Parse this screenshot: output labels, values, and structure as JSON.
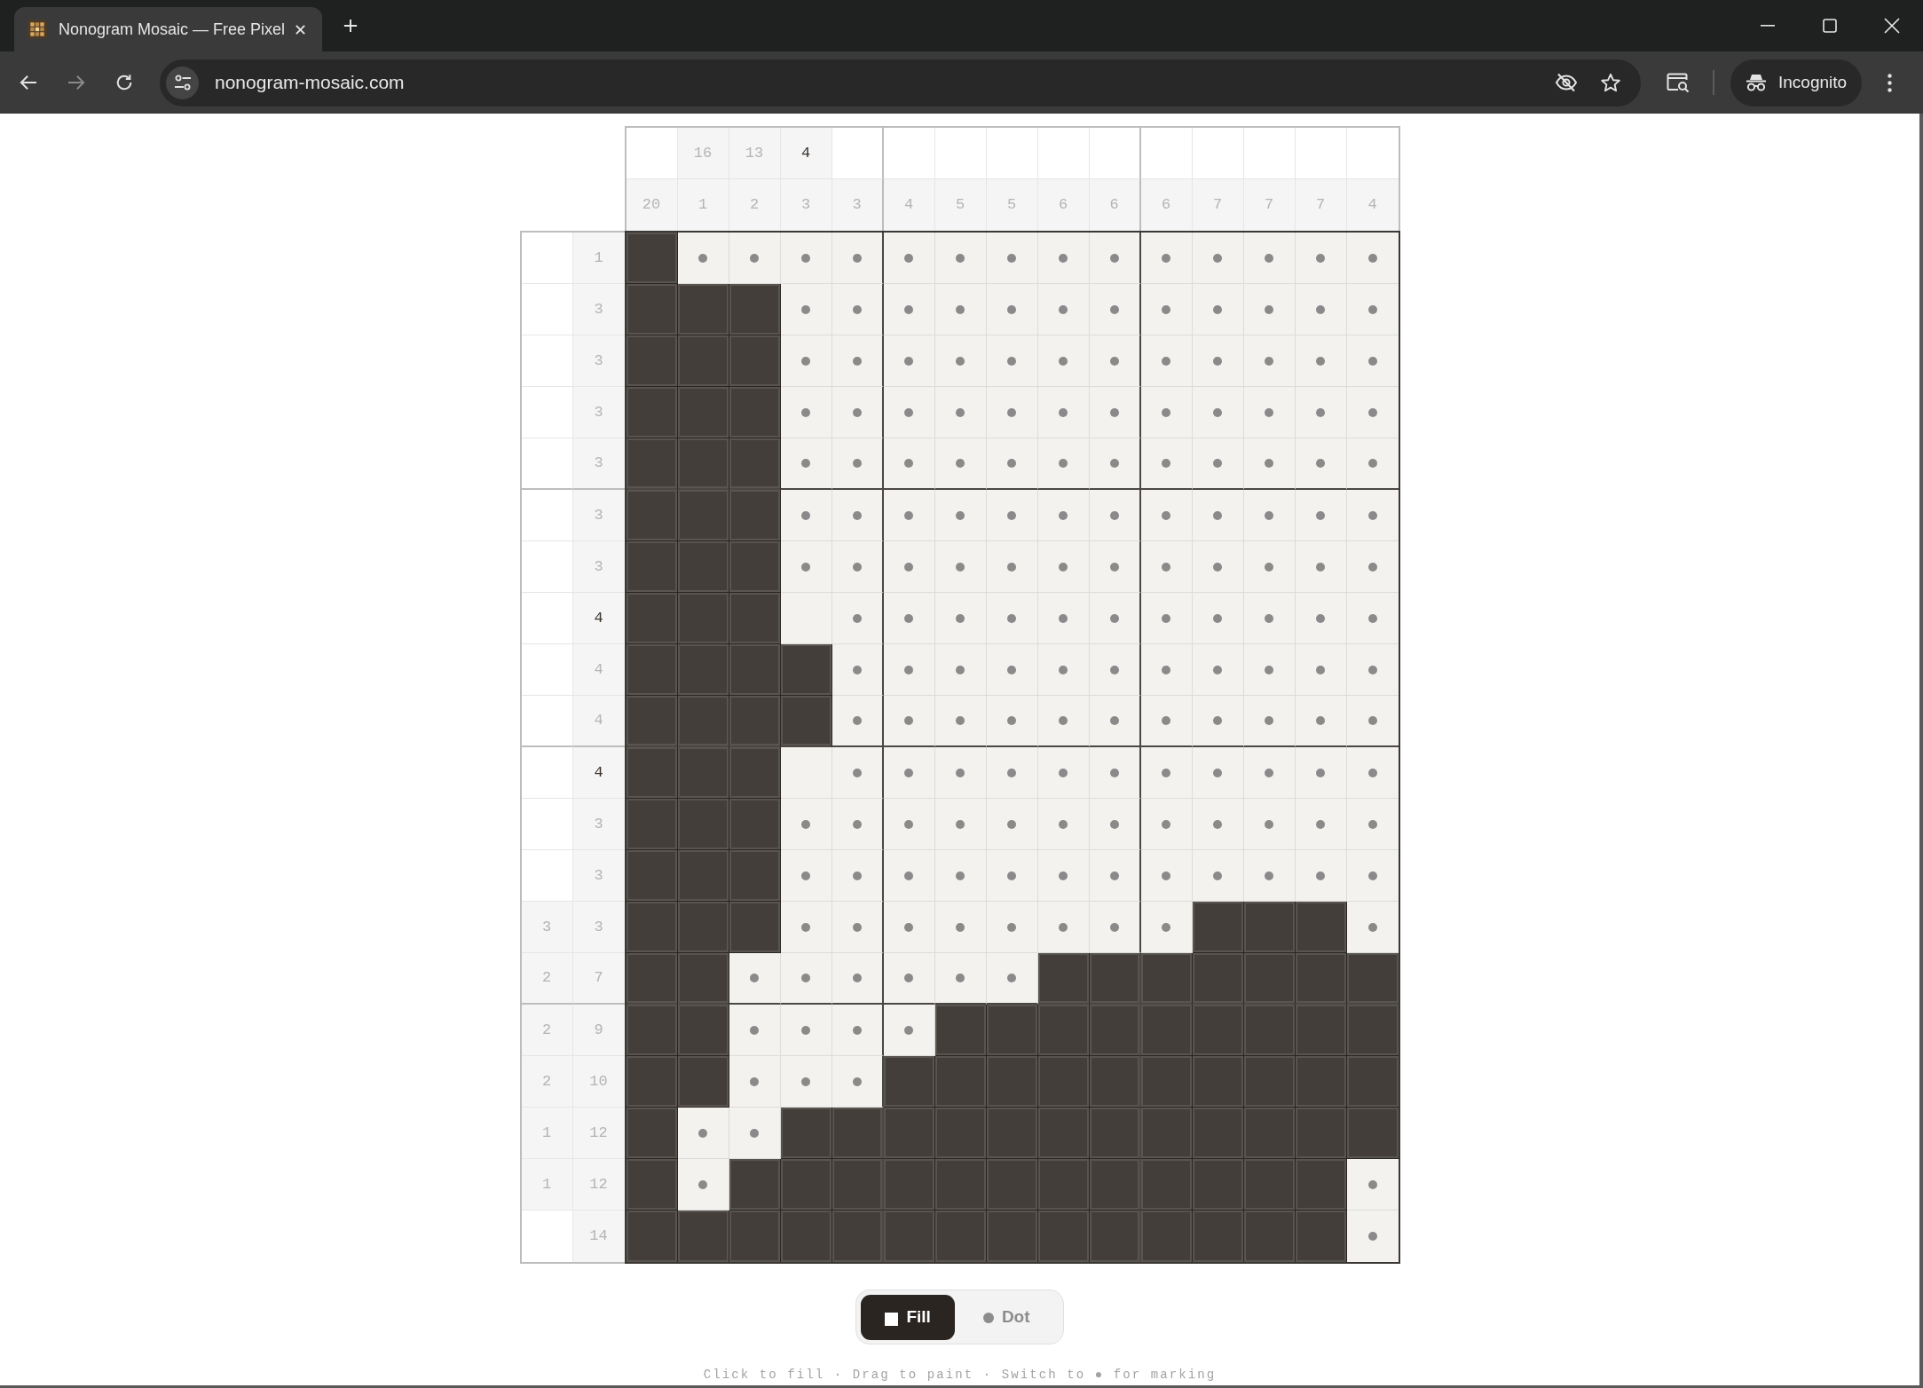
{
  "browser": {
    "tab_title": "Nonogram Mosaic — Free Pixel",
    "address": "nonogram-mosaic.com",
    "profile_label": "Incognito"
  },
  "column_clues": [
    [
      {
        "number": "20",
        "completed": true
      }
    ],
    [
      {
        "number": "16",
        "completed": true
      },
      {
        "number": "1",
        "completed": true
      }
    ],
    [
      {
        "number": "13",
        "completed": true
      },
      {
        "number": "2",
        "completed": true
      }
    ],
    [
      {
        "number": "4",
        "completed": false
      },
      {
        "number": "3",
        "completed": true
      }
    ],
    [
      {
        "number": "3",
        "completed": true
      }
    ],
    [
      {
        "number": "4",
        "completed": true
      }
    ],
    [
      {
        "number": "5",
        "completed": true
      }
    ],
    [
      {
        "number": "5",
        "completed": true
      }
    ],
    [
      {
        "number": "6",
        "completed": true
      }
    ],
    [
      {
        "number": "6",
        "completed": true
      }
    ],
    [
      {
        "number": "6",
        "completed": true
      }
    ],
    [
      {
        "number": "7",
        "completed": true
      }
    ],
    [
      {
        "number": "7",
        "completed": true
      }
    ],
    [
      {
        "number": "7",
        "completed": true
      }
    ],
    [
      {
        "number": "4",
        "completed": true
      }
    ]
  ],
  "row_clues": [
    [
      {
        "number": "1",
        "completed": true
      }
    ],
    [
      {
        "number": "3",
        "completed": true
      }
    ],
    [
      {
        "number": "3",
        "completed": true
      }
    ],
    [
      {
        "number": "3",
        "completed": true
      }
    ],
    [
      {
        "number": "3",
        "completed": true
      }
    ],
    [
      {
        "number": "3",
        "completed": true
      }
    ],
    [
      {
        "number": "3",
        "completed": true
      }
    ],
    [
      {
        "number": "4",
        "completed": false
      }
    ],
    [
      {
        "number": "4",
        "completed": true
      }
    ],
    [
      {
        "number": "4",
        "completed": true
      }
    ],
    [
      {
        "number": "4",
        "completed": false
      }
    ],
    [
      {
        "number": "3",
        "completed": true
      }
    ],
    [
      {
        "number": "3",
        "completed": true
      }
    ],
    [
      {
        "number": "3",
        "completed": true
      },
      {
        "number": "3",
        "completed": true
      }
    ],
    [
      {
        "number": "2",
        "completed": true
      },
      {
        "number": "7",
        "completed": true
      }
    ],
    [
      {
        "number": "2",
        "completed": true
      },
      {
        "number": "9",
        "completed": true
      }
    ],
    [
      {
        "number": "2",
        "completed": true
      },
      {
        "number": "10",
        "completed": true
      }
    ],
    [
      {
        "number": "1",
        "completed": true
      },
      {
        "number": "12",
        "completed": true
      }
    ],
    [
      {
        "number": "1",
        "completed": true
      },
      {
        "number": "12",
        "completed": true
      }
    ],
    [
      {
        "number": "14",
        "completed": true
      }
    ]
  ],
  "grid": [
    [
      {
        "kind": "filled"
      },
      {
        "kind": "dot"
      },
      {
        "kind": "dot"
      },
      {
        "kind": "dot"
      },
      {
        "kind": "dot"
      },
      {
        "kind": "dot"
      },
      {
        "kind": "dot"
      },
      {
        "kind": "dot"
      },
      {
        "kind": "dot"
      },
      {
        "kind": "dot"
      },
      {
        "kind": "dot"
      },
      {
        "kind": "dot"
      },
      {
        "kind": "dot"
      },
      {
        "kind": "dot"
      },
      {
        "kind": "dot"
      }
    ],
    [
      {
        "kind": "filled"
      },
      {
        "kind": "filled"
      },
      {
        "kind": "filled"
      },
      {
        "kind": "dot"
      },
      {
        "kind": "dot"
      },
      {
        "kind": "dot"
      },
      {
        "kind": "dot"
      },
      {
        "kind": "dot"
      },
      {
        "kind": "dot"
      },
      {
        "kind": "dot"
      },
      {
        "kind": "dot"
      },
      {
        "kind": "dot"
      },
      {
        "kind": "dot"
      },
      {
        "kind": "dot"
      },
      {
        "kind": "dot"
      }
    ],
    [
      {
        "kind": "filled"
      },
      {
        "kind": "filled"
      },
      {
        "kind": "filled"
      },
      {
        "kind": "dot"
      },
      {
        "kind": "dot"
      },
      {
        "kind": "dot"
      },
      {
        "kind": "dot"
      },
      {
        "kind": "dot"
      },
      {
        "kind": "dot"
      },
      {
        "kind": "dot"
      },
      {
        "kind": "dot"
      },
      {
        "kind": "dot"
      },
      {
        "kind": "dot"
      },
      {
        "kind": "dot"
      },
      {
        "kind": "dot"
      }
    ],
    [
      {
        "kind": "filled"
      },
      {
        "kind": "filled"
      },
      {
        "kind": "filled"
      },
      {
        "kind": "dot"
      },
      {
        "kind": "dot"
      },
      {
        "kind": "dot"
      },
      {
        "kind": "dot"
      },
      {
        "kind": "dot"
      },
      {
        "kind": "dot"
      },
      {
        "kind": "dot"
      },
      {
        "kind": "dot"
      },
      {
        "kind": "dot"
      },
      {
        "kind": "dot"
      },
      {
        "kind": "dot"
      },
      {
        "kind": "dot"
      }
    ],
    [
      {
        "kind": "filled"
      },
      {
        "kind": "filled"
      },
      {
        "kind": "filled"
      },
      {
        "kind": "dot"
      },
      {
        "kind": "dot"
      },
      {
        "kind": "dot"
      },
      {
        "kind": "dot"
      },
      {
        "kind": "dot"
      },
      {
        "kind": "dot"
      },
      {
        "kind": "dot"
      },
      {
        "kind": "dot"
      },
      {
        "kind": "dot"
      },
      {
        "kind": "dot"
      },
      {
        "kind": "dot"
      },
      {
        "kind": "dot"
      }
    ],
    [
      {
        "kind": "filled"
      },
      {
        "kind": "filled"
      },
      {
        "kind": "filled"
      },
      {
        "kind": "dot"
      },
      {
        "kind": "dot"
      },
      {
        "kind": "dot"
      },
      {
        "kind": "dot"
      },
      {
        "kind": "dot"
      },
      {
        "kind": "dot"
      },
      {
        "kind": "dot"
      },
      {
        "kind": "dot"
      },
      {
        "kind": "dot"
      },
      {
        "kind": "dot"
      },
      {
        "kind": "dot"
      },
      {
        "kind": "dot"
      }
    ],
    [
      {
        "kind": "filled"
      },
      {
        "kind": "filled"
      },
      {
        "kind": "filled"
      },
      {
        "kind": "dot"
      },
      {
        "kind": "dot"
      },
      {
        "kind": "dot"
      },
      {
        "kind": "dot"
      },
      {
        "kind": "dot"
      },
      {
        "kind": "dot"
      },
      {
        "kind": "dot"
      },
      {
        "kind": "dot"
      },
      {
        "kind": "dot"
      },
      {
        "kind": "dot"
      },
      {
        "kind": "dot"
      },
      {
        "kind": "dot"
      }
    ],
    [
      {
        "kind": "filled"
      },
      {
        "kind": "filled"
      },
      {
        "kind": "filled"
      },
      {
        "kind": "empty"
      },
      {
        "kind": "dot"
      },
      {
        "kind": "dot"
      },
      {
        "kind": "dot"
      },
      {
        "kind": "dot"
      },
      {
        "kind": "dot"
      },
      {
        "kind": "dot"
      },
      {
        "kind": "dot"
      },
      {
        "kind": "dot"
      },
      {
        "kind": "dot"
      },
      {
        "kind": "dot"
      },
      {
        "kind": "dot"
      }
    ],
    [
      {
        "kind": "filled"
      },
      {
        "kind": "filled"
      },
      {
        "kind": "filled"
      },
      {
        "kind": "filled"
      },
      {
        "kind": "dot"
      },
      {
        "kind": "dot"
      },
      {
        "kind": "dot"
      },
      {
        "kind": "dot"
      },
      {
        "kind": "dot"
      },
      {
        "kind": "dot"
      },
      {
        "kind": "dot"
      },
      {
        "kind": "dot"
      },
      {
        "kind": "dot"
      },
      {
        "kind": "dot"
      },
      {
        "kind": "dot"
      }
    ],
    [
      {
        "kind": "filled"
      },
      {
        "kind": "filled"
      },
      {
        "kind": "filled"
      },
      {
        "kind": "filled"
      },
      {
        "kind": "dot"
      },
      {
        "kind": "dot"
      },
      {
        "kind": "dot"
      },
      {
        "kind": "dot"
      },
      {
        "kind": "dot"
      },
      {
        "kind": "dot"
      },
      {
        "kind": "dot"
      },
      {
        "kind": "dot"
      },
      {
        "kind": "dot"
      },
      {
        "kind": "dot"
      },
      {
        "kind": "dot"
      }
    ],
    [
      {
        "kind": "filled"
      },
      {
        "kind": "filled"
      },
      {
        "kind": "filled"
      },
      {
        "kind": "empty"
      },
      {
        "kind": "dot"
      },
      {
        "kind": "dot"
      },
      {
        "kind": "dot"
      },
      {
        "kind": "dot"
      },
      {
        "kind": "dot"
      },
      {
        "kind": "dot"
      },
      {
        "kind": "dot"
      },
      {
        "kind": "dot"
      },
      {
        "kind": "dot"
      },
      {
        "kind": "dot"
      },
      {
        "kind": "dot"
      }
    ],
    [
      {
        "kind": "filled"
      },
      {
        "kind": "filled"
      },
      {
        "kind": "filled"
      },
      {
        "kind": "dot"
      },
      {
        "kind": "dot"
      },
      {
        "kind": "dot"
      },
      {
        "kind": "dot"
      },
      {
        "kind": "dot"
      },
      {
        "kind": "dot"
      },
      {
        "kind": "dot"
      },
      {
        "kind": "dot"
      },
      {
        "kind": "dot"
      },
      {
        "kind": "dot"
      },
      {
        "kind": "dot"
      },
      {
        "kind": "dot"
      }
    ],
    [
      {
        "kind": "filled"
      },
      {
        "kind": "filled"
      },
      {
        "kind": "filled"
      },
      {
        "kind": "dot"
      },
      {
        "kind": "dot"
      },
      {
        "kind": "dot"
      },
      {
        "kind": "dot"
      },
      {
        "kind": "dot"
      },
      {
        "kind": "dot"
      },
      {
        "kind": "dot"
      },
      {
        "kind": "dot"
      },
      {
        "kind": "dot"
      },
      {
        "kind": "dot"
      },
      {
        "kind": "dot"
      },
      {
        "kind": "dot"
      }
    ],
    [
      {
        "kind": "filled"
      },
      {
        "kind": "filled"
      },
      {
        "kind": "filled"
      },
      {
        "kind": "dot"
      },
      {
        "kind": "dot"
      },
      {
        "kind": "dot"
      },
      {
        "kind": "dot"
      },
      {
        "kind": "dot"
      },
      {
        "kind": "dot"
      },
      {
        "kind": "dot"
      },
      {
        "kind": "dot"
      },
      {
        "kind": "filled"
      },
      {
        "kind": "filled"
      },
      {
        "kind": "filled"
      },
      {
        "kind": "dot"
      }
    ],
    [
      {
        "kind": "filled"
      },
      {
        "kind": "filled"
      },
      {
        "kind": "dot"
      },
      {
        "kind": "dot"
      },
      {
        "kind": "dot"
      },
      {
        "kind": "dot"
      },
      {
        "kind": "dot"
      },
      {
        "kind": "dot"
      },
      {
        "kind": "filled"
      },
      {
        "kind": "filled"
      },
      {
        "kind": "filled"
      },
      {
        "kind": "filled"
      },
      {
        "kind": "filled"
      },
      {
        "kind": "filled"
      },
      {
        "kind": "filled"
      }
    ],
    [
      {
        "kind": "filled"
      },
      {
        "kind": "filled"
      },
      {
        "kind": "dot"
      },
      {
        "kind": "dot"
      },
      {
        "kind": "dot"
      },
      {
        "kind": "dot"
      },
      {
        "kind": "filled"
      },
      {
        "kind": "filled"
      },
      {
        "kind": "filled"
      },
      {
        "kind": "filled"
      },
      {
        "kind": "filled"
      },
      {
        "kind": "filled"
      },
      {
        "kind": "filled"
      },
      {
        "kind": "filled"
      },
      {
        "kind": "filled"
      }
    ],
    [
      {
        "kind": "filled"
      },
      {
        "kind": "filled"
      },
      {
        "kind": "dot"
      },
      {
        "kind": "dot"
      },
      {
        "kind": "dot"
      },
      {
        "kind": "filled"
      },
      {
        "kind": "filled"
      },
      {
        "kind": "filled"
      },
      {
        "kind": "filled"
      },
      {
        "kind": "filled"
      },
      {
        "kind": "filled"
      },
      {
        "kind": "filled"
      },
      {
        "kind": "filled"
      },
      {
        "kind": "filled"
      },
      {
        "kind": "filled"
      }
    ],
    [
      {
        "kind": "filled"
      },
      {
        "kind": "dot"
      },
      {
        "kind": "dot"
      },
      {
        "kind": "filled"
      },
      {
        "kind": "filled"
      },
      {
        "kind": "filled"
      },
      {
        "kind": "filled"
      },
      {
        "kind": "filled"
      },
      {
        "kind": "filled"
      },
      {
        "kind": "filled"
      },
      {
        "kind": "filled"
      },
      {
        "kind": "filled"
      },
      {
        "kind": "filled"
      },
      {
        "kind": "filled"
      },
      {
        "kind": "filled"
      }
    ],
    [
      {
        "kind": "filled"
      },
      {
        "kind": "dot"
      },
      {
        "kind": "filled"
      },
      {
        "kind": "filled"
      },
      {
        "kind": "filled"
      },
      {
        "kind": "filled"
      },
      {
        "kind": "filled"
      },
      {
        "kind": "filled"
      },
      {
        "kind": "filled"
      },
      {
        "kind": "filled"
      },
      {
        "kind": "filled"
      },
      {
        "kind": "filled"
      },
      {
        "kind": "filled"
      },
      {
        "kind": "filled"
      },
      {
        "kind": "dot"
      }
    ],
    [
      {
        "kind": "filled"
      },
      {
        "kind": "filled"
      },
      {
        "kind": "filled"
      },
      {
        "kind": "filled"
      },
      {
        "kind": "filled"
      },
      {
        "kind": "filled"
      },
      {
        "kind": "filled"
      },
      {
        "kind": "filled"
      },
      {
        "kind": "filled"
      },
      {
        "kind": "filled"
      },
      {
        "kind": "filled"
      },
      {
        "kind": "filled"
      },
      {
        "kind": "filled"
      },
      {
        "kind": "filled"
      },
      {
        "kind": "dot"
      }
    ]
  ],
  "tools": [
    {
      "kind": "fill",
      "label": "Fill",
      "selected": true
    },
    {
      "kind": "dot",
      "label": "Dot",
      "selected": false
    }
  ],
  "hint": "Click to fill · Drag to paint · Switch to ● for marking"
}
